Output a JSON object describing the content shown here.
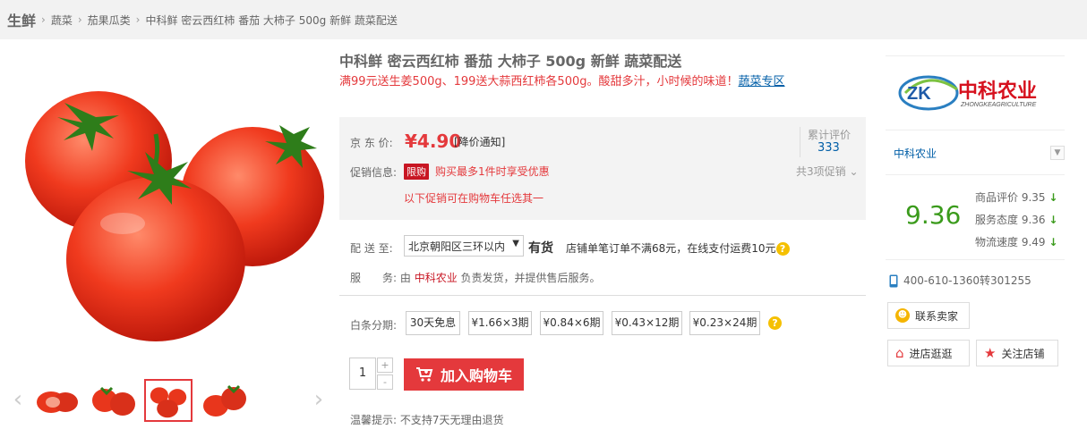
{
  "breadcrumb": {
    "root": "生鲜",
    "items": [
      "蔬菜",
      "茄果瓜类",
      "中科鲜 密云西红柿 番茄 大柿子 500g 新鲜 蔬菜配送"
    ]
  },
  "product": {
    "title": "中科鲜 密云西红柿 番茄 大柿子 500g 新鲜 蔬菜配送",
    "promo_text": "满99元送生姜500g、199送大蒜西红柿各500g。酸甜多汁，小时候的味道！",
    "promo_link": "蔬菜专区"
  },
  "price": {
    "label": "京 东 价:",
    "value": "¥4.90",
    "notice": "[降价通知]",
    "review_label": "累计评价",
    "review_count": "333",
    "promo_label": "促销信息:",
    "promo_tag": "限购",
    "promo_line": "购买最多1件时享受优惠",
    "promo_count": "共3项促销 ⌄",
    "promo_note": "以下促销可在购物车任选其一"
  },
  "delivery": {
    "label": "配 送 至:",
    "address": "北京朝阳区三环以内",
    "stock": "有货",
    "shipping": "店铺单笔订单不满68元，在线支付运费10元"
  },
  "service": {
    "label": "服　　务:",
    "prefix": "由 ",
    "shop": "中科农业",
    "suffix": " 负责发货，并提供售后服务。"
  },
  "installment": {
    "label": "白条分期:",
    "options": [
      "30天免息",
      "¥1.66×3期",
      "¥0.84×6期",
      "¥0.43×12期",
      "¥0.23×24期"
    ]
  },
  "purchase": {
    "quantity": "1",
    "plus": "+",
    "minus": "-",
    "cart_button": "加入购物车"
  },
  "tip": "温馨提示: 不支持7天无理由退货",
  "shop": {
    "logo_text": "中科农业",
    "logo_sub": "ZHONGKEAGRICULTURE",
    "logo_mark": "ZK",
    "name": "中科农业",
    "score": "9.36",
    "scores": [
      {
        "label": "商品评价",
        "value": "9.35"
      },
      {
        "label": "服务态度",
        "value": "9.36"
      },
      {
        "label": "物流速度",
        "value": "9.49"
      }
    ],
    "phone": "400-610-1360转301255",
    "contact_button": "联系卖家",
    "enter_button": "进店逛逛",
    "follow_button": "关注店铺"
  },
  "colors": {
    "accent": "#e4393c",
    "link": "#005ea7",
    "score": "#3b9b1c"
  }
}
